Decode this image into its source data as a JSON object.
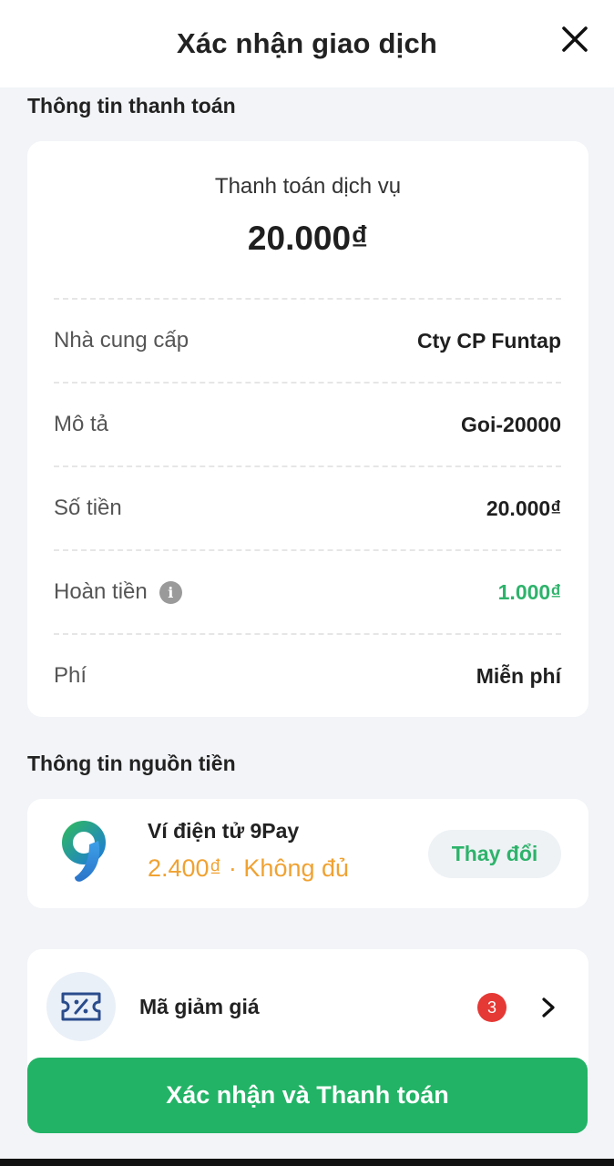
{
  "header": {
    "title": "Xác nhận giao dịch",
    "close_icon": "close-icon"
  },
  "payment_info": {
    "section_title": "Thông tin thanh toán",
    "label": "Thanh toán dịch vụ",
    "amount": "20.000₫",
    "rows": [
      {
        "label": "Nhà cung cấp",
        "value": "Cty CP Funtap"
      },
      {
        "label": "Mô tả",
        "value": "Goi-20000"
      },
      {
        "label": "Số tiền",
        "value": "20.000₫"
      },
      {
        "label": "Hoàn tiền",
        "value": "1.000₫",
        "value_color": "#2eb36b",
        "icon": "info-icon"
      },
      {
        "label": "Phí",
        "value": "Miễn phí"
      }
    ]
  },
  "source_info": {
    "section_title": "Thông tin nguồn tiền",
    "wallet_name": "Ví điện tử 9Pay",
    "wallet_balance": "2.400₫ · Không đủ",
    "change_label": "Thay đổi",
    "logo_icon": "9pay-logo-icon"
  },
  "voucher": {
    "label": "Mã giảm giá",
    "badge_count": "3",
    "icon": "ticket-percent-icon",
    "chevron_icon": "chevron-right-icon"
  },
  "confirm_button": {
    "label": "Xác nhận và Thanh toán",
    "color": "#22b366"
  }
}
